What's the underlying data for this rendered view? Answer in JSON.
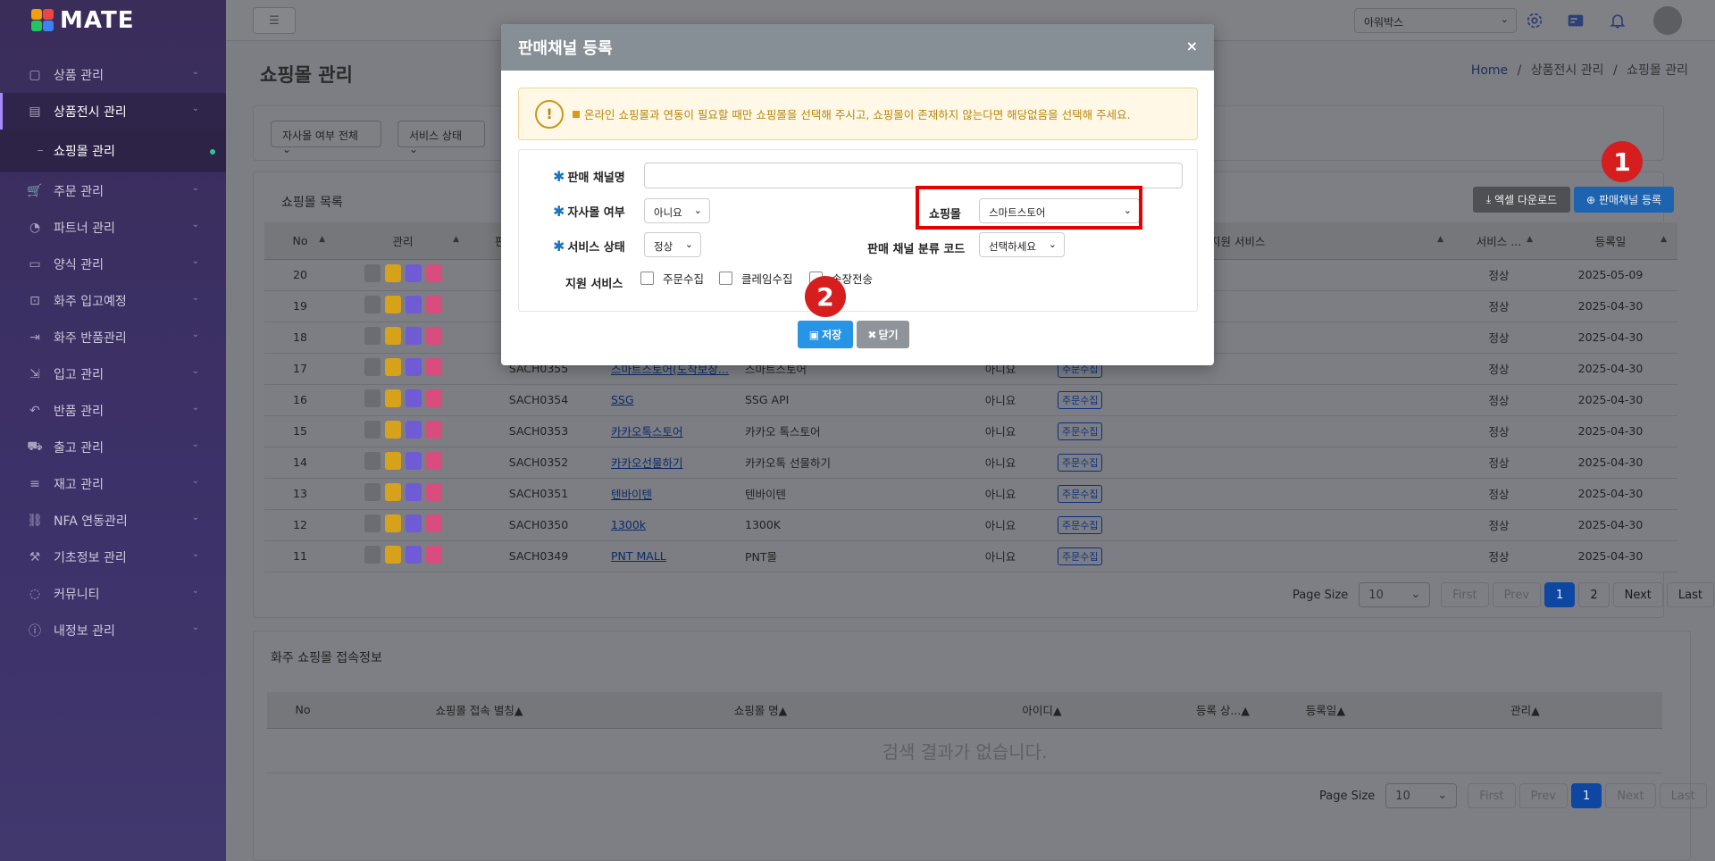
{
  "app": {
    "logo_text": "MATE"
  },
  "sidebar": {
    "items": [
      {
        "label": "상품 관리",
        "icon": "box-icon"
      },
      {
        "label": "상품전시 관리",
        "icon": "store-icon",
        "active": true
      },
      {
        "label": "주문 관리",
        "icon": "cart-icon"
      },
      {
        "label": "파트너 관리",
        "icon": "handshake-icon"
      },
      {
        "label": "양식 관리",
        "icon": "document-icon"
      },
      {
        "label": "화주 입고예정",
        "icon": "truck-in-icon"
      },
      {
        "label": "화주 반품관리",
        "icon": "return-icon"
      },
      {
        "label": "입고 관리",
        "icon": "login-icon"
      },
      {
        "label": "반품 관리",
        "icon": "undo-icon"
      },
      {
        "label": "출고 관리",
        "icon": "truck-icon"
      },
      {
        "label": "재고 관리",
        "icon": "stack-icon"
      },
      {
        "label": "NFA 연동관리",
        "icon": "link-icon"
      },
      {
        "label": "기초정보 관리",
        "icon": "wrench-icon"
      },
      {
        "label": "커뮤니티",
        "icon": "chat-icon"
      },
      {
        "label": "내정보 관리",
        "icon": "info-icon"
      }
    ],
    "submenu": {
      "label": "쇼핑몰 관리"
    }
  },
  "topbar": {
    "company_select": "아워박스"
  },
  "page": {
    "title": "쇼핑몰 관리",
    "breadcrumb": {
      "home": "Home",
      "sep": "/",
      "section": "상품전시 관리",
      "current": "쇼핑몰 관리"
    }
  },
  "filters": {
    "own_mall": "자사몰 여부 전체",
    "service_status": "서비스 상태"
  },
  "list": {
    "title": "쇼핑몰 목록",
    "excel_btn": "엑셀 다운로드",
    "register_btn": "판매채널 등록",
    "headers": {
      "no": "No",
      "manage": "관리",
      "code": "판",
      "support": "지원 서비스",
      "status": "서비스 ...",
      "reg_date": "등록일"
    },
    "rows": [
      {
        "no": "20",
        "code": "",
        "name": "",
        "mall": "",
        "own": "",
        "service": "",
        "status": "정상",
        "date": "2025-05-09"
      },
      {
        "no": "19",
        "code": "",
        "name": "",
        "mall": "",
        "own": "",
        "service": "",
        "status": "정상",
        "date": "2025-04-30"
      },
      {
        "no": "18",
        "code": "",
        "name": "",
        "mall": "",
        "own": "",
        "service": "",
        "status": "정상",
        "date": "2025-04-30"
      },
      {
        "no": "17",
        "code": "SACH0355",
        "name": "스마트스토어(도착보장...",
        "mall": "스마트스토어",
        "own": "아니요",
        "service": "주문수집",
        "status": "정상",
        "date": "2025-04-30"
      },
      {
        "no": "16",
        "code": "SACH0354",
        "name": "SSG",
        "mall": "SSG API",
        "own": "아니요",
        "service": "주문수집",
        "status": "정상",
        "date": "2025-04-30"
      },
      {
        "no": "15",
        "code": "SACH0353",
        "name": "카카오톡스토어",
        "mall": "카카오 톡스토어",
        "own": "아니요",
        "service": "주문수집",
        "status": "정상",
        "date": "2025-04-30"
      },
      {
        "no": "14",
        "code": "SACH0352",
        "name": "카카오선물하기",
        "mall": "카카오톡 선물하기",
        "own": "아니요",
        "service": "주문수집",
        "status": "정상",
        "date": "2025-04-30"
      },
      {
        "no": "13",
        "code": "SACH0351",
        "name": "텐바이텐",
        "mall": "텐바이텐",
        "own": "아니요",
        "service": "주문수집",
        "status": "정상",
        "date": "2025-04-30"
      },
      {
        "no": "12",
        "code": "SACH0350",
        "name": "1300k",
        "mall": "1300K",
        "own": "아니요",
        "service": "주문수집",
        "status": "정상",
        "date": "2025-04-30"
      },
      {
        "no": "11",
        "code": "SACH0349",
        "name": "PNT MALL",
        "mall": "PNT몰",
        "own": "아니요",
        "service": "주문수집",
        "status": "정상",
        "date": "2025-04-30"
      }
    ],
    "pager": {
      "label": "Page Size",
      "size": "10",
      "first": "First",
      "prev": "Prev",
      "p1": "1",
      "p2": "2",
      "next": "Next",
      "last": "Last"
    }
  },
  "section2": {
    "title": "화주 쇼핑몰 접속정보",
    "headers": {
      "no": "No",
      "alias": "쇼핑몰 접속 별칭",
      "mall": "쇼핑몰 명",
      "id": "아이디",
      "reg_status": "등록 상...",
      "reg_date": "등록일",
      "manage": "관리"
    },
    "empty": "검색 결과가 없습니다.",
    "pager": {
      "label": "Page Size",
      "size": "10",
      "first": "First",
      "prev": "Prev",
      "p1": "1",
      "next": "Next",
      "last": "Last"
    }
  },
  "modal": {
    "title": "판매채널 등록",
    "close": "×",
    "notice": "온라인 쇼핑몰과 연동이 필요할 때만 쇼핑몰을 선택해 주시고, 쇼핑몰이 존재하지 않는다면 해당없음을 선택해 주세요.",
    "labels": {
      "channel_name": "판매 채널명",
      "own_mall": "자사몰 여부",
      "service_status": "서비스 상태",
      "support": "지원 서비스",
      "mall": "쇼핑몰",
      "class_code": "판매 채널 분류 코드"
    },
    "values": {
      "channel_name": "",
      "own_mall": "아니요",
      "service_status": "정상",
      "mall": "스마트스토어",
      "class_code": "선택하세요"
    },
    "checkboxes": [
      "주문수집",
      "클레임수집",
      "송장전송"
    ],
    "save_btn": "저장",
    "close_btn": "닫기"
  },
  "annotations": {
    "step1": "1",
    "step2": "2"
  }
}
